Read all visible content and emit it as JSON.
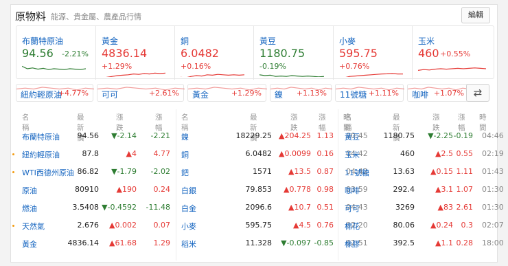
{
  "header": {
    "title": "原物料",
    "subtitle": "能源、貴金屬、農產品行情",
    "edit_label": "編輯"
  },
  "cards": [
    {
      "name": "布蘭特原油",
      "price": "94.56",
      "change": "-2.21%",
      "dir": "down"
    },
    {
      "name": "黃金",
      "price": "4836.14",
      "change": "+1.29%",
      "dir": "up"
    },
    {
      "name": "銅",
      "price": "6.0482",
      "change": "+0.16%",
      "dir": "up"
    },
    {
      "name": "黃豆",
      "price": "1180.75",
      "change": "-0.19%",
      "dir": "down"
    },
    {
      "name": "小麥",
      "price": "595.75",
      "change": "+0.76%",
      "dir": "up"
    },
    {
      "name": "玉米",
      "price": "460",
      "change": "+0.55%",
      "dir": "up"
    }
  ],
  "chips": [
    {
      "name": "紐約輕原油",
      "change": "+4.77%"
    },
    {
      "name": "可可",
      "change": "+2.61%"
    },
    {
      "name": "黃金",
      "change": "+1.29%"
    },
    {
      "name": "鎳",
      "change": "+1.13%"
    },
    {
      "name": "11號糖",
      "change": "+1.11%"
    },
    {
      "name": "咖啡",
      "change": "+1.07%"
    }
  ],
  "swap_icon": "⇄",
  "table_headers": {
    "name": "名稱",
    "price": "最新價",
    "change": "漲跌",
    "pct": "漲幅",
    "time": "時間"
  },
  "table_left": [
    {
      "name": "布蘭特原油",
      "price": "94.56",
      "change": "▼-2.14",
      "pct": "-2.21",
      "dir": "down",
      "dot": false
    },
    {
      "name": "紐約輕原油",
      "price": "87.8",
      "change": "▲4",
      "pct": "4.77",
      "dir": "up",
      "dot": true
    },
    {
      "name": "WTI西德州原油",
      "price": "86.82",
      "change": "▼-1.79",
      "pct": "-2.02",
      "dir": "down",
      "dot": true
    },
    {
      "name": "原油",
      "price": "80910",
      "change": "▲190",
      "pct": "0.24",
      "dir": "up",
      "dot": false
    },
    {
      "name": "燃油",
      "price": "3.5408",
      "change": "▼-0.4592",
      "pct": "-11.48",
      "dir": "down",
      "dot": false
    },
    {
      "name": "天然氣",
      "price": "2.676",
      "change": "▲0.002",
      "pct": "0.07",
      "dir": "up",
      "dot": true
    },
    {
      "name": "黃金",
      "price": "4836.14",
      "change": "▲61.68",
      "pct": "1.29",
      "dir": "up",
      "dot": false
    }
  ],
  "table_mid": [
    {
      "name": "鎳",
      "price": "18229.25",
      "change": "▲204.25",
      "pct": "1.13",
      "time": "00:45",
      "dir": "up"
    },
    {
      "name": "銅",
      "price": "6.0482",
      "change": "▲0.0099",
      "pct": "0.16",
      "time": "04:42",
      "dir": "up"
    },
    {
      "name": "鈀",
      "price": "1571",
      "change": "▲13.5",
      "pct": "0.87",
      "time": "04:42",
      "dir": "up"
    },
    {
      "name": "白銀",
      "price": "79.853",
      "change": "▲0.778",
      "pct": "0.98",
      "time": "03:59",
      "dir": "up"
    },
    {
      "name": "白金",
      "price": "2096.6",
      "change": "▲10.7",
      "pct": "0.51",
      "time": "04:43",
      "dir": "up"
    },
    {
      "name": "小麥",
      "price": "595.75",
      "change": "▲4.5",
      "pct": "0.76",
      "time": "02:20",
      "dir": "up"
    },
    {
      "name": "稻米",
      "price": "11.328",
      "change": "▼-0.097",
      "pct": "-0.85",
      "time": "02:51",
      "dir": "down"
    }
  ],
  "table_right": [
    {
      "name": "黃豆",
      "price": "1180.75",
      "change": "▼-2.25",
      "pct": "-0.19",
      "time": "04:46",
      "dir": "down"
    },
    {
      "name": "玉米",
      "price": "460",
      "change": "▲2.5",
      "pct": "0.55",
      "time": "02:19",
      "dir": "up"
    },
    {
      "name": "11號糖",
      "price": "13.63",
      "change": "▲0.15",
      "pct": "1.11",
      "time": "01:43",
      "dir": "up"
    },
    {
      "name": "咖啡",
      "price": "292.4",
      "change": "▲3.1",
      "pct": "1.07",
      "time": "01:30",
      "dir": "up"
    },
    {
      "name": "可可",
      "price": "3269",
      "change": "▲83",
      "pct": "2.61",
      "time": "01:30",
      "dir": "up"
    },
    {
      "name": "棉花",
      "price": "80.06",
      "change": "▲0.24",
      "pct": "0.3",
      "time": "02:07",
      "dir": "up"
    },
    {
      "name": "橡膠",
      "price": "392.5",
      "change": "▲1.1",
      "pct": "0.28",
      "time": "18:00",
      "dir": "up"
    }
  ],
  "colors": {
    "up": "#e53935",
    "down": "#2e7d32",
    "link": "#1565c0"
  }
}
